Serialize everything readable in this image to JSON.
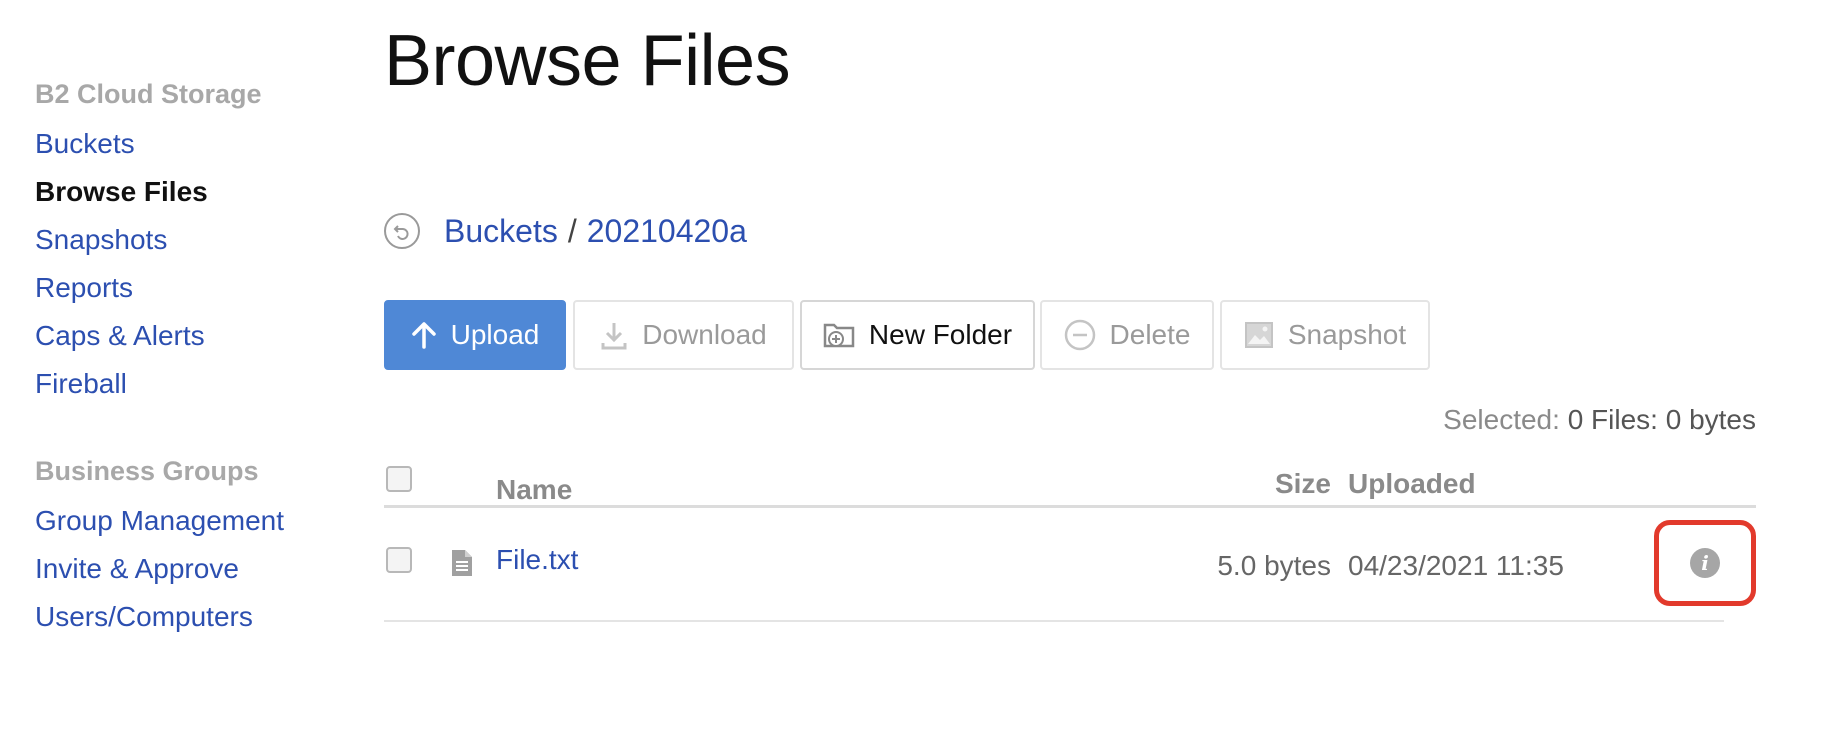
{
  "sidebar": {
    "section_storage": "B2 Cloud Storage",
    "storage_items": [
      {
        "label": "Buckets",
        "active": false
      },
      {
        "label": "Browse Files",
        "active": true
      },
      {
        "label": "Snapshots",
        "active": false
      },
      {
        "label": "Reports",
        "active": false
      },
      {
        "label": "Caps & Alerts",
        "active": false
      },
      {
        "label": "Fireball",
        "active": false
      }
    ],
    "section_groups": "Business Groups",
    "group_items": [
      {
        "label": "Group Management"
      },
      {
        "label": "Invite & Approve"
      },
      {
        "label": "Users/Computers"
      }
    ]
  },
  "page": {
    "title": "Browse Files"
  },
  "breadcrumb": {
    "icon": "back-circle-icon",
    "root": "Buckets",
    "separator": "/",
    "bucket": "20210420a"
  },
  "toolbar": {
    "upload": "Upload",
    "download": "Download",
    "new_folder": "New Folder",
    "delete": "Delete",
    "snapshot": "Snapshot"
  },
  "selection": {
    "label": "Selected:",
    "value": "0 Files: 0 bytes"
  },
  "table": {
    "headers": {
      "name": "Name",
      "size": "Size",
      "uploaded": "Uploaded"
    },
    "rows": [
      {
        "name": "File.txt",
        "size": "5.0 bytes",
        "uploaded": "04/23/2021 11:35",
        "info_icon": "i"
      }
    ]
  },
  "colors": {
    "link": "#2c4fb0",
    "primary_button": "#4f88d6",
    "highlight": "#e23a2c"
  }
}
